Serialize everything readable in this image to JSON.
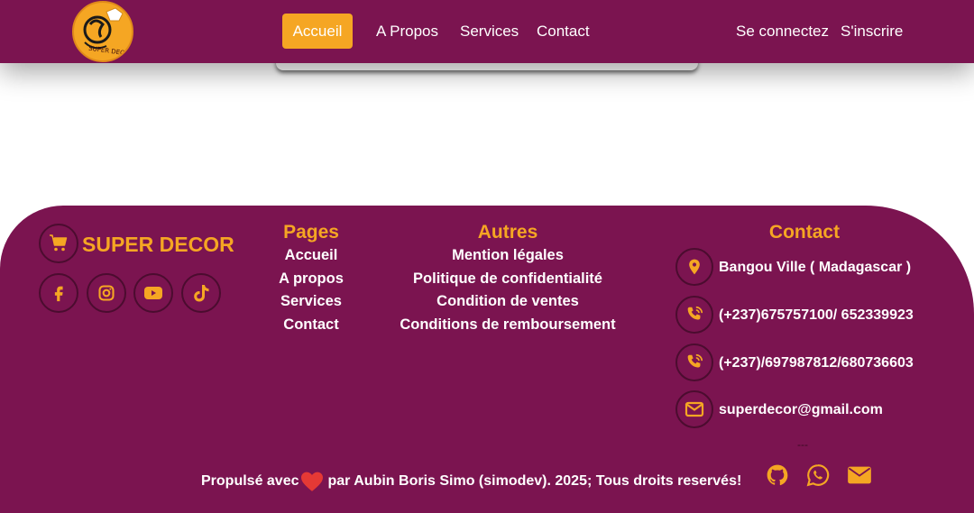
{
  "header": {
    "logo_text": "SUPER DECOR",
    "nav": [
      {
        "label": "Accueil",
        "active": true
      },
      {
        "label": "A Propos"
      },
      {
        "label": "Services"
      },
      {
        "label": "Contact"
      }
    ],
    "auth": {
      "login": "Se connectez",
      "signup": "S'inscrire"
    }
  },
  "footer": {
    "brand": {
      "name": "SUPER DECOR",
      "icon": "cart-icon"
    },
    "socials": [
      "facebook-icon",
      "instagram-icon",
      "youtube-icon",
      "tiktok-icon"
    ],
    "pages": {
      "title": "Pages",
      "links": [
        "Accueil",
        "A propos",
        "Services",
        "Contact"
      ]
    },
    "autres": {
      "title": "Autres",
      "links": [
        "Mention légales",
        "Politique de confidentialité",
        "Condition de ventes",
        "Conditions de remboursement"
      ]
    },
    "contact": {
      "title": "Contact",
      "items": [
        {
          "icon": "location-icon",
          "text": "Bangou Ville ( Madagascar )"
        },
        {
          "icon": "phone-icon",
          "text": "(+237)675757100/ 652339923"
        },
        {
          "icon": "phone-icon",
          "text": "(+237)/697987812/680736603"
        },
        {
          "icon": "envelope-icon",
          "text": "superdecor@gmail.com"
        }
      ]
    },
    "dash": "---",
    "copyright": {
      "before": "Propulsé avec",
      "after": "par Aubin Boris Simo (simodev). 2025; Tous droits reservés!"
    },
    "bottom_icons": [
      "github-icon",
      "whatsapp-icon",
      "envelope-icon"
    ]
  },
  "colors": {
    "primary": "#7b1450",
    "accent": "#f5a623",
    "heart": "#e53935",
    "text": "#ffffff"
  }
}
